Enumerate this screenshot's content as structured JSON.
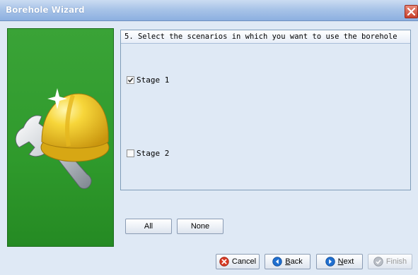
{
  "window": {
    "title": "Borehole Wizard",
    "close_icon": "close-icon"
  },
  "step": {
    "header": "5. Select the scenarios in which you want to use the borehole"
  },
  "scenarios": [
    {
      "label": "Stage 1",
      "checked": true
    },
    {
      "label": "Stage 2",
      "checked": false
    }
  ],
  "selection": {
    "all_label": "All",
    "none_label": "None"
  },
  "nav": {
    "cancel": {
      "label": "Cancel",
      "icon": "cancel-icon",
      "enabled": true
    },
    "back": {
      "label_mnemonic": "B",
      "label_rest": "ack",
      "icon": "back-arrow-icon",
      "enabled": true
    },
    "next": {
      "label_mnemonic": "N",
      "label_rest": "ext",
      "icon": "next-arrow-icon",
      "enabled": true
    },
    "finish": {
      "label": "Finish",
      "icon": "finish-icon",
      "enabled": false
    }
  },
  "colors": {
    "side_panel": "#2f9a2c",
    "accent": "#1f6fd0",
    "cancel_red": "#d83a24"
  },
  "illustration": {
    "icon": "hardhat-wrench-illustration"
  }
}
